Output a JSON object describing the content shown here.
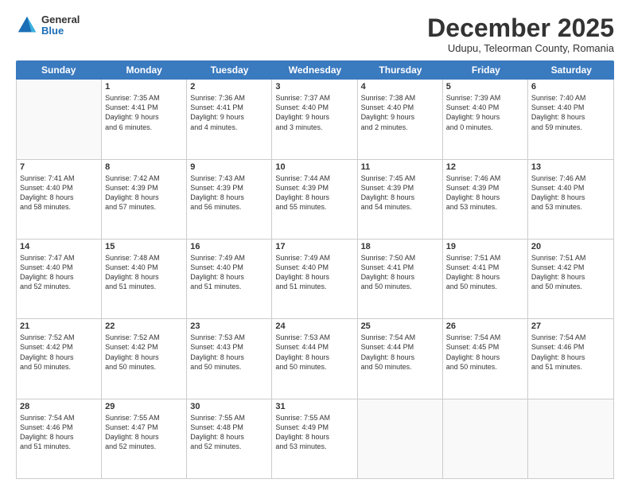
{
  "header": {
    "logo_general": "General",
    "logo_blue": "Blue",
    "title": "December 2025",
    "subtitle": "Udupu, Teleorman County, Romania"
  },
  "days_of_week": [
    "Sunday",
    "Monday",
    "Tuesday",
    "Wednesday",
    "Thursday",
    "Friday",
    "Saturday"
  ],
  "weeks": [
    [
      {
        "day": "",
        "info": ""
      },
      {
        "day": "1",
        "info": "Sunrise: 7:35 AM\nSunset: 4:41 PM\nDaylight: 9 hours\nand 6 minutes."
      },
      {
        "day": "2",
        "info": "Sunrise: 7:36 AM\nSunset: 4:41 PM\nDaylight: 9 hours\nand 4 minutes."
      },
      {
        "day": "3",
        "info": "Sunrise: 7:37 AM\nSunset: 4:40 PM\nDaylight: 9 hours\nand 3 minutes."
      },
      {
        "day": "4",
        "info": "Sunrise: 7:38 AM\nSunset: 4:40 PM\nDaylight: 9 hours\nand 2 minutes."
      },
      {
        "day": "5",
        "info": "Sunrise: 7:39 AM\nSunset: 4:40 PM\nDaylight: 9 hours\nand 0 minutes."
      },
      {
        "day": "6",
        "info": "Sunrise: 7:40 AM\nSunset: 4:40 PM\nDaylight: 8 hours\nand 59 minutes."
      }
    ],
    [
      {
        "day": "7",
        "info": "Sunrise: 7:41 AM\nSunset: 4:40 PM\nDaylight: 8 hours\nand 58 minutes."
      },
      {
        "day": "8",
        "info": "Sunrise: 7:42 AM\nSunset: 4:39 PM\nDaylight: 8 hours\nand 57 minutes."
      },
      {
        "day": "9",
        "info": "Sunrise: 7:43 AM\nSunset: 4:39 PM\nDaylight: 8 hours\nand 56 minutes."
      },
      {
        "day": "10",
        "info": "Sunrise: 7:44 AM\nSunset: 4:39 PM\nDaylight: 8 hours\nand 55 minutes."
      },
      {
        "day": "11",
        "info": "Sunrise: 7:45 AM\nSunset: 4:39 PM\nDaylight: 8 hours\nand 54 minutes."
      },
      {
        "day": "12",
        "info": "Sunrise: 7:46 AM\nSunset: 4:39 PM\nDaylight: 8 hours\nand 53 minutes."
      },
      {
        "day": "13",
        "info": "Sunrise: 7:46 AM\nSunset: 4:40 PM\nDaylight: 8 hours\nand 53 minutes."
      }
    ],
    [
      {
        "day": "14",
        "info": "Sunrise: 7:47 AM\nSunset: 4:40 PM\nDaylight: 8 hours\nand 52 minutes."
      },
      {
        "day": "15",
        "info": "Sunrise: 7:48 AM\nSunset: 4:40 PM\nDaylight: 8 hours\nand 51 minutes."
      },
      {
        "day": "16",
        "info": "Sunrise: 7:49 AM\nSunset: 4:40 PM\nDaylight: 8 hours\nand 51 minutes."
      },
      {
        "day": "17",
        "info": "Sunrise: 7:49 AM\nSunset: 4:40 PM\nDaylight: 8 hours\nand 51 minutes."
      },
      {
        "day": "18",
        "info": "Sunrise: 7:50 AM\nSunset: 4:41 PM\nDaylight: 8 hours\nand 50 minutes."
      },
      {
        "day": "19",
        "info": "Sunrise: 7:51 AM\nSunset: 4:41 PM\nDaylight: 8 hours\nand 50 minutes."
      },
      {
        "day": "20",
        "info": "Sunrise: 7:51 AM\nSunset: 4:42 PM\nDaylight: 8 hours\nand 50 minutes."
      }
    ],
    [
      {
        "day": "21",
        "info": "Sunrise: 7:52 AM\nSunset: 4:42 PM\nDaylight: 8 hours\nand 50 minutes."
      },
      {
        "day": "22",
        "info": "Sunrise: 7:52 AM\nSunset: 4:42 PM\nDaylight: 8 hours\nand 50 minutes."
      },
      {
        "day": "23",
        "info": "Sunrise: 7:53 AM\nSunset: 4:43 PM\nDaylight: 8 hours\nand 50 minutes."
      },
      {
        "day": "24",
        "info": "Sunrise: 7:53 AM\nSunset: 4:44 PM\nDaylight: 8 hours\nand 50 minutes."
      },
      {
        "day": "25",
        "info": "Sunrise: 7:54 AM\nSunset: 4:44 PM\nDaylight: 8 hours\nand 50 minutes."
      },
      {
        "day": "26",
        "info": "Sunrise: 7:54 AM\nSunset: 4:45 PM\nDaylight: 8 hours\nand 50 minutes."
      },
      {
        "day": "27",
        "info": "Sunrise: 7:54 AM\nSunset: 4:46 PM\nDaylight: 8 hours\nand 51 minutes."
      }
    ],
    [
      {
        "day": "28",
        "info": "Sunrise: 7:54 AM\nSunset: 4:46 PM\nDaylight: 8 hours\nand 51 minutes."
      },
      {
        "day": "29",
        "info": "Sunrise: 7:55 AM\nSunset: 4:47 PM\nDaylight: 8 hours\nand 52 minutes."
      },
      {
        "day": "30",
        "info": "Sunrise: 7:55 AM\nSunset: 4:48 PM\nDaylight: 8 hours\nand 52 minutes."
      },
      {
        "day": "31",
        "info": "Sunrise: 7:55 AM\nSunset: 4:49 PM\nDaylight: 8 hours\nand 53 minutes."
      },
      {
        "day": "",
        "info": ""
      },
      {
        "day": "",
        "info": ""
      },
      {
        "day": "",
        "info": ""
      }
    ]
  ]
}
